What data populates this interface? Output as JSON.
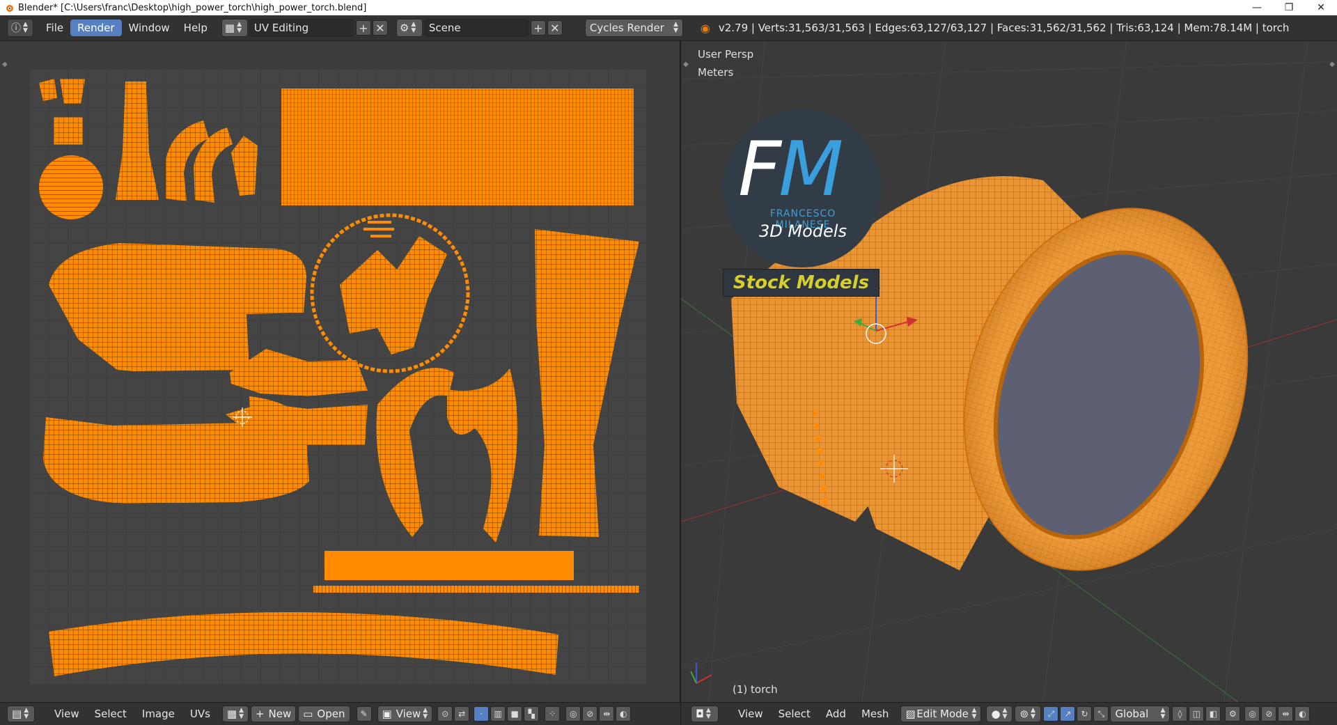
{
  "window": {
    "title": "Blender* [C:\\Users\\franc\\Desktop\\high_power_torch\\high_power_torch.blend]",
    "controls": {
      "minimize": "—",
      "maximize": "❐",
      "close": "✕"
    }
  },
  "info_header": {
    "menus": [
      "File",
      "Render",
      "Window",
      "Help"
    ],
    "active_menu": "Render",
    "screen_layout": "UV Editing",
    "scene": "Scene",
    "render_engine": "Cycles Render",
    "stats": "v2.79 | Verts:31,563/31,563 | Edges:63,127/63,127 | Faces:31,562/31,562 | Tris:63,124 | Mem:78.14M | torch"
  },
  "uv_editor": {
    "footer": {
      "menus": [
        "View",
        "Select",
        "Image",
        "UVs"
      ],
      "new_label": "New",
      "open_label": "Open",
      "view_label": "View"
    }
  },
  "view3d": {
    "view_name": "User Persp",
    "units": "Meters",
    "object_label": "(1) torch",
    "footer": {
      "menus": [
        "View",
        "Select",
        "Add",
        "Mesh"
      ],
      "mode": "Edit Mode",
      "orientation": "Global"
    },
    "watermark": {
      "fm_f": "F",
      "fm_m": "M",
      "name": "FRANCESCO MILANESE",
      "subtitle": "3D Models",
      "banner": "Stock Models"
    }
  },
  "colors": {
    "accent": "#5680c2",
    "uv_orange": "#ff8c00",
    "header_bg": "#323232",
    "editor_bg": "#3c3c3c"
  }
}
